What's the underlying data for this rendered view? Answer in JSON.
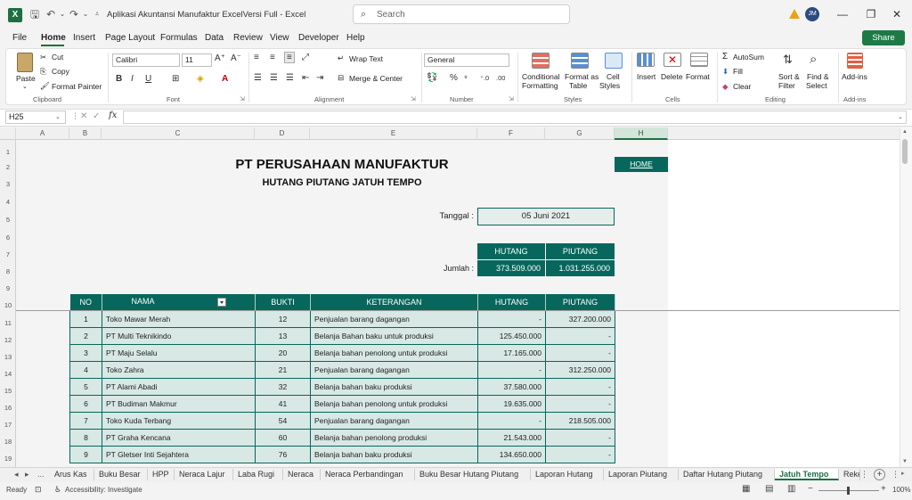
{
  "titlebar": {
    "app_logo": "X",
    "doc_title": "Aplikasi Akuntansi Manufaktur ExcelVersi Full  -  Excel",
    "search_placeholder": "Search",
    "user_initials": "JM"
  },
  "menu": [
    "File",
    "Home",
    "Insert",
    "Page Layout",
    "Formulas",
    "Data",
    "Review",
    "View",
    "Developer",
    "Help"
  ],
  "share_label": "Share",
  "ribbon": {
    "clipboard": {
      "paste": "Paste",
      "cut": "Cut",
      "copy": "Copy",
      "format_painter": "Format Painter",
      "label": "Clipboard"
    },
    "font": {
      "name": "Calibri",
      "size": "11",
      "label": "Font"
    },
    "alignment": {
      "wrap": "Wrap Text",
      "merge": "Merge & Center",
      "label": "Alignment"
    },
    "number": {
      "format": "General",
      "label": "Number"
    },
    "styles": {
      "conditional": "Conditional",
      "conditional2": "Formatting",
      "format_table": "Format as",
      "format_table2": "Table",
      "cell_styles": "Cell",
      "cell_styles2": "Styles",
      "label": "Styles"
    },
    "cells": {
      "insert": "Insert",
      "delete": "Delete",
      "format": "Format",
      "label": "Cells"
    },
    "editing": {
      "autosum": "AutoSum",
      "fill": "Fill",
      "clear": "Clear",
      "sort": "Sort &",
      "sort2": "Filter",
      "find": "Find &",
      "find2": "Select",
      "label": "Editing"
    },
    "addins": {
      "label_btn": "Add-ins",
      "label": "Add-ins"
    }
  },
  "formula_bar": {
    "cell_ref": "H25",
    "fx": "fx",
    "value": ""
  },
  "columns": [
    "A",
    "B",
    "C",
    "D",
    "E",
    "F",
    "G",
    "H"
  ],
  "rows": [
    "1",
    "2",
    "3",
    "4",
    "5",
    "6",
    "7",
    "8",
    "9",
    "10",
    "11",
    "12",
    "13",
    "14",
    "15",
    "16",
    "17",
    "18",
    "19"
  ],
  "sheet": {
    "company": "PT PERUSAHAAN MANUFAKTUR",
    "subtitle": "HUTANG PIUTANG JATUH TEMPO",
    "home_link": "HOME",
    "tanggal_label": "Tanggal :",
    "tanggal_value": "05 Juni 2021",
    "summary": {
      "hutang_head": "HUTANG",
      "piutang_head": "PIUTANG",
      "jumlah_label": "Jumlah :",
      "hutang_total": "373.509.000",
      "piutang_total": "1.031.255.000"
    },
    "table": {
      "headers": [
        "NO",
        "NAMA",
        "BUKTI",
        "KETERANGAN",
        "HUTANG",
        "PIUTANG"
      ],
      "rows": [
        [
          "1",
          "Toko Mawar Merah",
          "12",
          "Penjualan barang dagangan",
          "-",
          "327.200.000"
        ],
        [
          "2",
          "PT Multi Teknikindo",
          "13",
          "Belanja Bahan baku untuk produksi",
          "125.450.000",
          "-"
        ],
        [
          "3",
          "PT Maju Selalu",
          "20",
          "Belanja bahan penolong untuk produksi",
          "17.165.000",
          "-"
        ],
        [
          "4",
          "Toko Zahra",
          "21",
          "Penjualan barang dagangan",
          "-",
          "312.250.000"
        ],
        [
          "5",
          "PT Alami Abadi",
          "32",
          "Belanja bahan baku produksi",
          "37.580.000",
          "-"
        ],
        [
          "6",
          "PT Budiman Makmur",
          "41",
          "Belanja bahan penolong untuk produksi",
          "19.635.000",
          "-"
        ],
        [
          "7",
          "Toko Kuda Terbang",
          "54",
          "Penjualan barang dagangan",
          "-",
          "218.505.000"
        ],
        [
          "8",
          "PT Graha Kencana",
          "60",
          "Belanja bahan penolong produksi",
          "21.543.000",
          "-"
        ],
        [
          "9",
          "PT Gletser Inti Sejahtera",
          "76",
          "Belanja bahan baku produksi",
          "134.650.000",
          "-"
        ]
      ]
    }
  },
  "sheet_tabs": [
    "Arus Kas",
    "Buku Besar",
    "HPP",
    "Neraca Lajur",
    "Laba Rugi",
    "Neraca",
    "Neraca Perbandingan",
    "Buku Besar Hutang Piutang",
    "Laporan Hutang",
    "Laporan Piutang",
    "Daftar Hutang Piutang",
    "Jatuh Tempo",
    "Reke ..."
  ],
  "tab_nav": [
    "◂",
    "▸",
    "..."
  ],
  "status": {
    "ready": "Ready",
    "accessibility": "Accessibility: Investigate",
    "zoom": "100%"
  },
  "colors": {
    "accent": "#07675c",
    "excel_green": "#1d6f42",
    "table_fill": "#d8e8e5"
  }
}
